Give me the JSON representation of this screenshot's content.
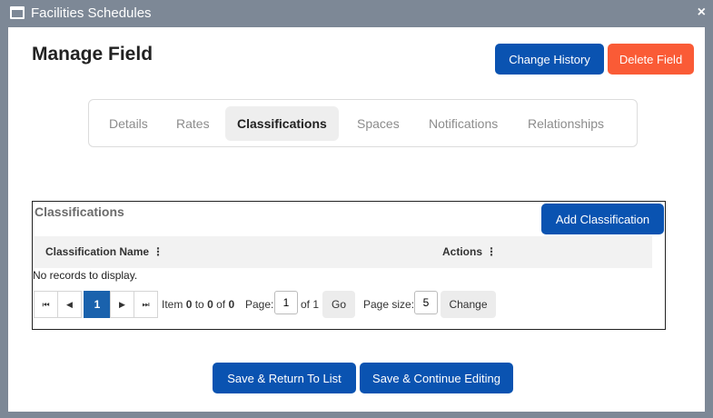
{
  "window": {
    "title": "Facilities Schedules",
    "close_glyph": "×"
  },
  "page": {
    "title": "Manage Field"
  },
  "header_buttons": {
    "change_history": "Change History",
    "delete_field": "Delete Field"
  },
  "tabs": [
    {
      "label": "Details",
      "active": false
    },
    {
      "label": "Rates",
      "active": false
    },
    {
      "label": "Classifications",
      "active": true
    },
    {
      "label": "Spaces",
      "active": false
    },
    {
      "label": "Notifications",
      "active": false
    },
    {
      "label": "Relationships",
      "active": false
    }
  ],
  "grid": {
    "caption": "Classifications",
    "add_button": "Add Classification",
    "columns": [
      "Classification Name",
      "Actions"
    ],
    "empty_text": "No records to display.",
    "pager": {
      "first": "⏮",
      "prev": "◀",
      "current_page": "1",
      "next": "▶",
      "last": "⏭",
      "item_prefix": "Item",
      "item_from": "0",
      "item_to_word": "to",
      "item_to": "0",
      "item_of_word": "of",
      "item_total": "0",
      "page_label": "Page:",
      "page_value": "1",
      "of_pages": "of 1",
      "go_label": "Go",
      "page_size_label": "Page size:",
      "page_size_value": "5",
      "change_label": "Change"
    }
  },
  "footer_buttons": {
    "save_return": "Save & Return To List",
    "save_continue": "Save & Continue Editing"
  },
  "colors": {
    "primary": "#0a53b1",
    "danger": "#fa5b36",
    "titlebar": "#7d8896"
  }
}
